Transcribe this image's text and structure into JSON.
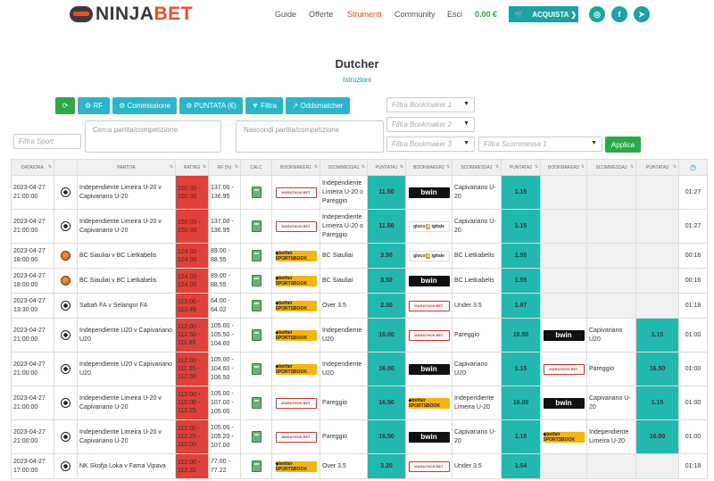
{
  "nav": {
    "logo": {
      "part1": "NINJA",
      "part2": "BET"
    },
    "links": [
      "Guide",
      "Offerte",
      "Strumenti",
      "Community",
      "Esci"
    ],
    "active": "Strumenti",
    "balance": "0.00 €",
    "buy_label": "ACQUISTA ❯",
    "social": [
      "instagram-icon",
      "facebook-icon",
      "telegram-icon"
    ]
  },
  "page": {
    "title": "Dutcher",
    "instructions": "Istruzioni"
  },
  "toolbar": {
    "refresh_icon": "refresh-icon",
    "rf_label": "RF",
    "commission_label": "Commissione",
    "stake_label": "PUNTATA (€)",
    "filter_label": "Filtra",
    "oddsmatcher_label": "Oddsmatcher",
    "filter_bookmaker1": "Filtra Bookmaker 1",
    "filter_bookmaker2": "Filtra Bookmaker 2",
    "filter_bookmaker3": "Filtra Bookmaker 3",
    "filter_sport": "Filtra Sport",
    "search_match": "Cerca partita/competizione",
    "hide_match": "Nascondi partita/competizione",
    "filter_bet1": "Filtra Scommessa 1",
    "apply_label": "Applica"
  },
  "table": {
    "headers": [
      "DATA/ORA",
      "",
      "PARTITA",
      "RATING",
      "RF (%)",
      "CALC",
      "BOOKMAKER1",
      "SCOMMESSA1",
      "PUNTATA1",
      "BOOKMAKER2",
      "SCOMMESSA2",
      "PUNTATA2",
      "BOOKMAKER3",
      "SCOMMESSA3",
      "PUNTATA3",
      "clock-icon"
    ],
    "rows": [
      {
        "date": "2023-04-27",
        "time": "21:00:00",
        "sport": "football",
        "match": "Independiente Limeira U-20 v Capivariano U-20",
        "rating": [
          "150.00 -",
          "150.00"
        ],
        "rf": [
          "137.00 -",
          "136.95"
        ],
        "bk1": "marathon",
        "bet1": "Independiente Limeira U-20 o Pareggio",
        "stake1": "11.50",
        "bk2": "bwin",
        "bet2": "Capivariano U-20",
        "stake2": "1.15",
        "bk3": "",
        "bet3": "",
        "stake3": "",
        "remaining": "01:27",
        "h": 2
      },
      {
        "date": "2023-04-27",
        "time": "21:00:00",
        "sport": "football",
        "match": "Independiente Limeira U-20 v Capivariano U-20",
        "rating": [
          "150.00 -",
          "150.00"
        ],
        "rf": [
          "137.00 -",
          "136.95"
        ],
        "bk1": "marathon",
        "bet1": "Independiente Limeira U-20 o Pareggio",
        "stake1": "11.50",
        "bk2": "goldbet",
        "bet2": "Capivariano U-20",
        "stake2": "1.15",
        "bk3": "",
        "bet3": "",
        "stake3": "",
        "remaining": "01:27",
        "h": 2
      },
      {
        "date": "2023-04-27",
        "time": "18:00:00",
        "sport": "basketball",
        "match": "BC Siauliai v BC Lietkabelis",
        "rating": [
          "124.00 -",
          "124.00"
        ],
        "rf": [
          "89.00 -",
          "88.55"
        ],
        "bk1": "betfair",
        "bet1": "BC Siauliai",
        "stake1": "3.50",
        "bk2": "goldbet",
        "bet2": "BC Lietkabelis",
        "stake2": "1.55",
        "bk3": "",
        "bet3": "",
        "stake3": "",
        "remaining": "00:16",
        "h": 1
      },
      {
        "date": "2023-04-27",
        "time": "18:00:00",
        "sport": "basketball",
        "match": "BC Siauliai v BC Lietkabelis",
        "rating": [
          "124.00 -",
          "124.00"
        ],
        "rf": [
          "89.00 -",
          "88.55"
        ],
        "bk1": "betfair",
        "bet1": "BC Siauliai",
        "stake1": "3.50",
        "bk2": "bwin",
        "bet2": "BC Lietkabelis",
        "stake2": "1.55",
        "bk3": "",
        "bet3": "",
        "stake3": "",
        "remaining": "00:16",
        "h": 1
      },
      {
        "date": "2023-04-27",
        "time": "13:30:00",
        "sport": "football",
        "match": "Sabah FA v Selangor FA",
        "rating": [
          "113.00 -",
          "113.49"
        ],
        "rf": [
          "64.00 -",
          "64.02"
        ],
        "bk1": "betfair",
        "bet1": "Over 3.5",
        "stake1": "2.30",
        "bk2": "marathon",
        "bet2": "Under 3.5",
        "stake2": "1.97",
        "bk3": "",
        "bet3": "",
        "stake3": "",
        "remaining": "01:18",
        "h": 1
      },
      {
        "date": "2023-04-27",
        "time": "21:00:00",
        "sport": "football",
        "match": "Independiente U20 v Capivariano U20",
        "rating": [
          "112.00 -",
          "112.50 -",
          "111.65"
        ],
        "rf": [
          "105.00 -",
          "105.50 -",
          "104.60"
        ],
        "bk1": "betfair",
        "bet1": "Independiente U20",
        "stake1": "16.00",
        "bk2": "marathon",
        "bet2": "Pareggio",
        "stake2": "16.50",
        "bk3": "bwin",
        "bet3": "Capivariano U20",
        "stake3": "1.15",
        "remaining": "01:00",
        "h": 2
      },
      {
        "date": "2023-04-27",
        "time": "21:00:00",
        "sport": "football",
        "match": "Independiente U20 v Capivariano U20",
        "rating": [
          "112.00 -",
          "111.65 -",
          "112.50"
        ],
        "rf": [
          "105.00 -",
          "104.60 -",
          "106.50"
        ],
        "bk1": "betfair",
        "bet1": "Independiente U20",
        "stake1": "16.00",
        "bk2": "bwin",
        "bet2": "Capivariano U20",
        "stake2": "1.15",
        "bk3": "marathon",
        "bet3": "Pareggio",
        "stake3": "16.50",
        "remaining": "01:00",
        "h": 2
      },
      {
        "date": "2023-04-27",
        "time": "21:00:00",
        "sport": "football",
        "match": "Independiente Limeira U-20 v Capivariano U-20",
        "rating": [
          "112.00 -",
          "110.00 -",
          "112.25"
        ],
        "rf": [
          "105.00 -",
          "107.00 -",
          "105.00"
        ],
        "bk1": "marathon",
        "bet1": "Pareggio",
        "stake1": "16.50",
        "bk2": "betfair",
        "bet2": "Independiente Limeira U-20",
        "stake2": "16.00",
        "bk3": "bwin",
        "bet3": "Capivariano U-20",
        "stake3": "1.15",
        "remaining": "01:00",
        "h": 2
      },
      {
        "date": "2023-04-27",
        "time": "21:00:00",
        "sport": "football",
        "match": "Independiente Limeira U-20 v Capivariano U-20",
        "rating": [
          "112.00 -",
          "112.25 -",
          "110.00"
        ],
        "rf": [
          "105.00 -",
          "105.20 -",
          "107.00"
        ],
        "bk1": "marathon",
        "bet1": "Pareggio",
        "stake1": "16.50",
        "bk2": "bwin",
        "bet2": "Capivariano U-20",
        "stake2": "1.15",
        "bk3": "betfair",
        "bet3": "Independiente Limeira U-20",
        "stake3": "16.00",
        "remaining": "01:00",
        "h": 2
      },
      {
        "date": "2023-04-27",
        "time": "17:00:00",
        "sport": "football",
        "match": "NK Skofja Loka v Fama Vipava",
        "rating": [
          "112.00 -",
          "112.32"
        ],
        "rf": [
          "77.00 -",
          "77.22"
        ],
        "bk1": "betfair",
        "bet1": "Over 3.5",
        "stake1": "3.20",
        "bk2": "marathon",
        "bet2": "Under 3.5",
        "stake2": "1.54",
        "bk3": "",
        "bet3": "",
        "stake3": "",
        "remaining": "01:18",
        "h": 1
      }
    ]
  },
  "colors": {
    "accent": "#1aa3a3",
    "quote": "#22b8b0",
    "rating": "#e0413a",
    "toolbar": "#2bb5cc",
    "apply": "#2aa84a"
  }
}
